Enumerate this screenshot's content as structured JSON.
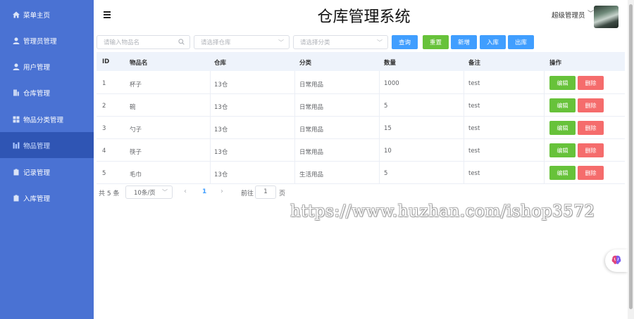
{
  "sidebar": {
    "items": [
      {
        "label": "菜单主页",
        "icon": "home-icon",
        "active": false
      },
      {
        "label": "管理员管理",
        "icon": "user-icon",
        "active": false
      },
      {
        "label": "用户管理",
        "icon": "user-icon",
        "active": false
      },
      {
        "label": "仓库管理",
        "icon": "building-icon",
        "active": false
      },
      {
        "label": "物品分类管理",
        "icon": "grid-icon",
        "active": false
      },
      {
        "label": "物品管理",
        "icon": "bar-chart-icon",
        "active": true
      },
      {
        "label": "记录管理",
        "icon": "clipboard-icon",
        "active": false
      },
      {
        "label": "入库管理",
        "icon": "clipboard-icon",
        "active": false
      }
    ]
  },
  "header": {
    "title": "仓库管理系统",
    "user_name": "超级管理员"
  },
  "search": {
    "name_placeholder": "请输入物品名",
    "warehouse_placeholder": "请选择仓库",
    "category_placeholder": "请选择分类"
  },
  "toolbar": {
    "query": "查询",
    "reset": "重置",
    "add": "新增",
    "inbound": "入库",
    "outbound": "出库"
  },
  "table": {
    "columns": [
      "ID",
      "物品名",
      "仓库",
      "分类",
      "数量",
      "备注",
      "操作"
    ],
    "rows": [
      {
        "id": "1",
        "name": "杯子",
        "warehouse": "13仓",
        "category": "日常用品",
        "quantity": "1000",
        "note": "test",
        "edit": "编辑",
        "delete": "删除"
      },
      {
        "id": "2",
        "name": "碗",
        "warehouse": "13仓",
        "category": "日常用品",
        "quantity": "5",
        "note": "test",
        "edit": "编辑",
        "delete": "删除"
      },
      {
        "id": "3",
        "name": "勺子",
        "warehouse": "13仓",
        "category": "日常用品",
        "quantity": "15",
        "note": "test",
        "edit": "编辑",
        "delete": "删除"
      },
      {
        "id": "4",
        "name": "筷子",
        "warehouse": "13仓",
        "category": "日常用品",
        "quantity": "10",
        "note": "test",
        "edit": "编辑",
        "delete": "删除"
      },
      {
        "id": "5",
        "name": "毛巾",
        "warehouse": "13仓",
        "category": "生活用品",
        "quantity": "5",
        "note": "test",
        "edit": "编辑",
        "delete": "删除"
      }
    ]
  },
  "pagination": {
    "total": "共 5 条",
    "page_size": "10条/页",
    "current": "1",
    "goto_label": "前往",
    "goto_value": "1",
    "page_suffix": "页"
  },
  "watermark": "https://www.huzhan.com/ishop3572",
  "colors": {
    "sidebar_bg": "#4a72d3",
    "sidebar_active": "#2f55b4",
    "primary": "#409eff",
    "success": "#67c23a",
    "danger": "#f56c6c"
  }
}
